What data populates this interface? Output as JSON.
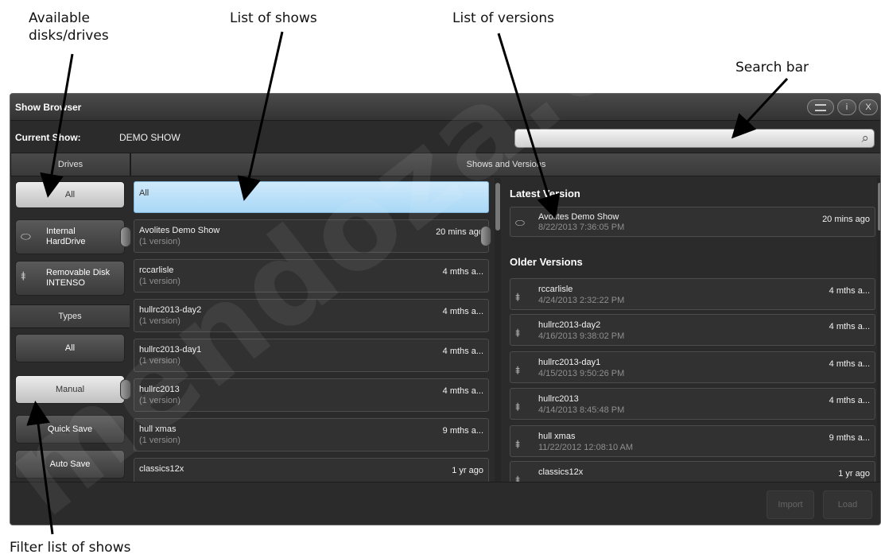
{
  "annotations": {
    "drives": "Available\ndisks/drives",
    "shows": "List of shows",
    "versions": "List of versions",
    "search": "Search bar",
    "filter": "Filter list of shows"
  },
  "watermark": "mendoza.com.",
  "window": {
    "title": "Show Browser",
    "current_show_label": "Current Show:",
    "current_show_value": "DEMO SHOW",
    "search_icon": "search-icon"
  },
  "headers": {
    "drives": "Drives",
    "shows_versions": "Shows and Versions",
    "types": "Types"
  },
  "drives": [
    {
      "label": "All",
      "icon": ""
    },
    {
      "label": "Internal\nHardDrive",
      "icon": "harddrive-icon"
    },
    {
      "label": "Removable Disk\nINTENSO",
      "icon": "usb-icon"
    }
  ],
  "types": [
    {
      "label": "All"
    },
    {
      "label": "Manual"
    },
    {
      "label": "Quick Save"
    },
    {
      "label": "Auto Save"
    }
  ],
  "shows": {
    "all_label": "All",
    "items": [
      {
        "name": "Avolites Demo Show",
        "sub": "(1 version)",
        "age": "20 mins ago"
      },
      {
        "name": "rccarlisle",
        "sub": "(1 version)",
        "age": "4 mths a..."
      },
      {
        "name": "hullrc2013-day2",
        "sub": "(1 version)",
        "age": "4 mths a..."
      },
      {
        "name": "hullrc2013-day1",
        "sub": "(1 version)",
        "age": "4 mths a..."
      },
      {
        "name": "hullrc2013",
        "sub": "(1 version)",
        "age": "4 mths a..."
      },
      {
        "name": "hull xmas",
        "sub": "(1 version)",
        "age": "9 mths a..."
      },
      {
        "name": "classics12x",
        "sub": "",
        "age": "1 yr ago"
      }
    ]
  },
  "versions": {
    "latest_heading": "Latest Version",
    "latest": {
      "name": "Avolites Demo Show",
      "date": "8/22/2013 7:36:05 PM",
      "age": "20 mins ago"
    },
    "older_heading": "Older Versions",
    "older": [
      {
        "name": "rccarlisle",
        "date": "4/24/2013 2:32:22 PM",
        "age": "4 mths a..."
      },
      {
        "name": "hullrc2013-day2",
        "date": "4/16/2013 9:38:02 PM",
        "age": "4 mths a..."
      },
      {
        "name": "hullrc2013-day1",
        "date": "4/15/2013 9:50:26 PM",
        "age": "4 mths a..."
      },
      {
        "name": "hullrc2013",
        "date": "4/14/2013 8:45:48 PM",
        "age": "4 mths a..."
      },
      {
        "name": "hull xmas",
        "date": "11/22/2012 12:08:10 AM",
        "age": "9 mths a..."
      },
      {
        "name": "classics12x",
        "date": "",
        "age": "1 yr ago"
      }
    ]
  },
  "footer": {
    "import": "Import",
    "load": "Load"
  },
  "title_buttons": {
    "info": "i",
    "close": "X"
  }
}
